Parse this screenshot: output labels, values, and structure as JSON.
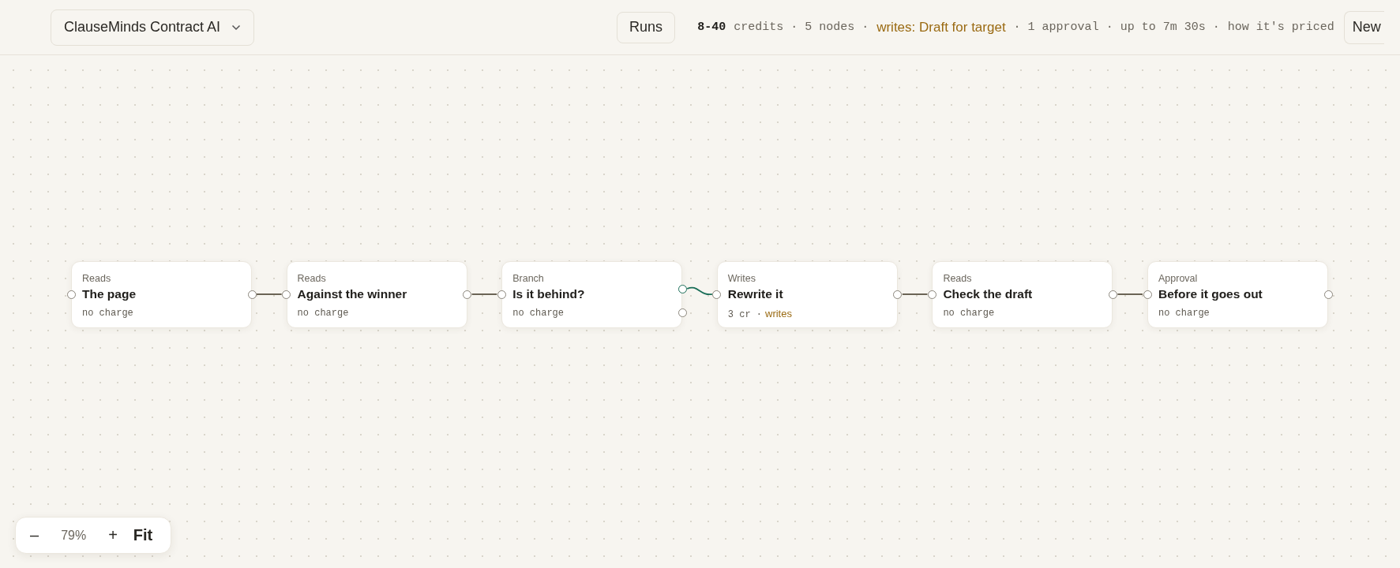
{
  "project": {
    "name": "ClauseMinds Contract AI"
  },
  "runs_button": "Runs",
  "summary": {
    "credits": "8-40",
    "credits_label": "credits · 5 nodes ·",
    "writes": "writes: Draft for target",
    "details": "· 1 approval · up to 7m 30s ·",
    "pricing_link": "how it's priced"
  },
  "new_button": "New",
  "nodes": [
    {
      "kind": "reads",
      "type_label": "Reads",
      "title": "The page",
      "cost": "no charge"
    },
    {
      "kind": "reads",
      "type_label": "Reads",
      "title": "Against the winner",
      "cost": "no charge"
    },
    {
      "kind": "branch",
      "type_label": "Branch",
      "title": "Is it behind?",
      "cost": "no charge"
    },
    {
      "kind": "writes",
      "type_label": "Writes",
      "title": "Rewrite it",
      "cost": "3 cr ·",
      "tag": "writes"
    },
    {
      "kind": "reads",
      "type_label": "Reads",
      "title": "Check the draft",
      "cost": "no charge"
    },
    {
      "kind": "approval",
      "type_label": "Approval",
      "title": "Before it goes out",
      "cost": "no charge"
    }
  ],
  "edges": [
    {
      "kind": "straight",
      "color": "#6b6455"
    },
    {
      "kind": "straight",
      "color": "#6b6455"
    },
    {
      "kind": "curve",
      "color": "#1a6e58"
    },
    {
      "kind": "straight",
      "color": "#6b6455"
    },
    {
      "kind": "straight",
      "color": "#6b6455"
    }
  ],
  "zoom": {
    "zoom_out": "–",
    "level": "79%",
    "zoom_in": "+",
    "fit": "Fit"
  }
}
